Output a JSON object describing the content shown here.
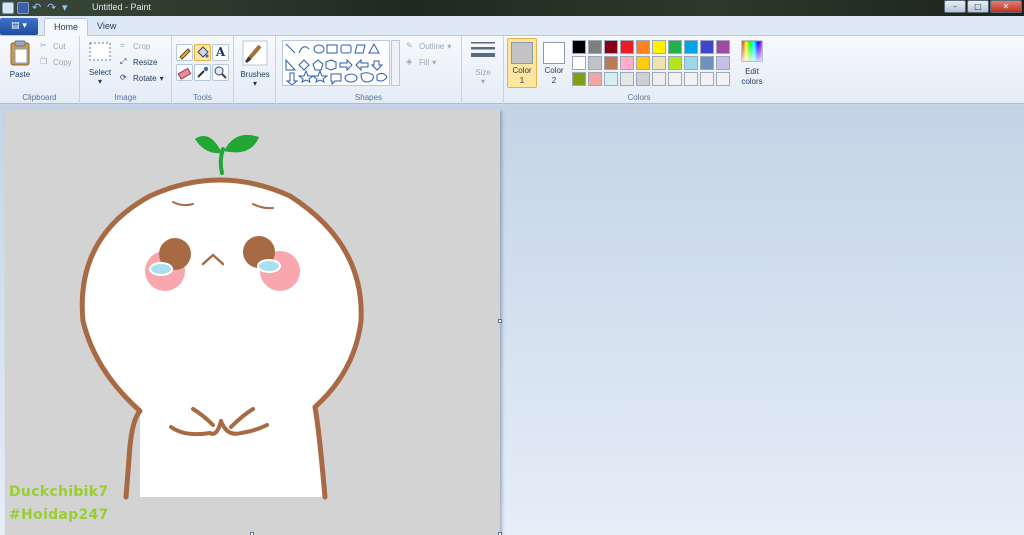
{
  "window": {
    "title": "Untitled - Paint",
    "controls": [
      "–",
      "□",
      "✕"
    ]
  },
  "tabs": [
    {
      "label": "Home"
    },
    {
      "label": "View"
    }
  ],
  "ribbon": {
    "clipboard": {
      "group": "Clipboard",
      "paste": "Paste",
      "cut": "Cut",
      "copy": "Copy"
    },
    "image": {
      "group": "Image",
      "select": "Select",
      "crop": "Crop",
      "resize": "Resize",
      "rotate": "Rotate"
    },
    "tools": {
      "group": "Tools"
    },
    "brushes": {
      "label": "Brushes"
    },
    "shapes": {
      "group": "Shapes",
      "outline": "Outline",
      "fill": "Fill"
    },
    "size": {
      "label": "Size"
    },
    "colors": {
      "group": "Colors",
      "color1_label": "Color",
      "color1_num": "1",
      "color2_label": "Color",
      "color2_num": "2",
      "color1_value": "#c3c3c3",
      "color2_value": "#ffffff",
      "edit": "Edit colors",
      "palette": [
        "#000000",
        "#7f7f7f",
        "#880015",
        "#ed1c24",
        "#ff7f27",
        "#fff200",
        "#22b14c",
        "#00a2e8",
        "#3f48cc",
        "#a349a4",
        "#ffffff",
        "#c3c3c3",
        "#b97a57",
        "#ffaec9",
        "#ffc90e",
        "#efe4b0",
        "#b5e61d",
        "#99d9ea",
        "#7092be",
        "#c8bfe7",
        "#7f9f1a",
        "#f4a6a6",
        "#d6eef2",
        "#e6e6e6",
        "#cfcfcf",
        "#ededed",
        "#f2f2f2",
        "#f2f2f2",
        "#f2f2f2",
        "#f2f2f2"
      ]
    }
  },
  "canvas": {
    "background": "#d3d3d3",
    "watermark_line1": "Duckchibik7",
    "watermark_line2": "#Hoidap247"
  }
}
